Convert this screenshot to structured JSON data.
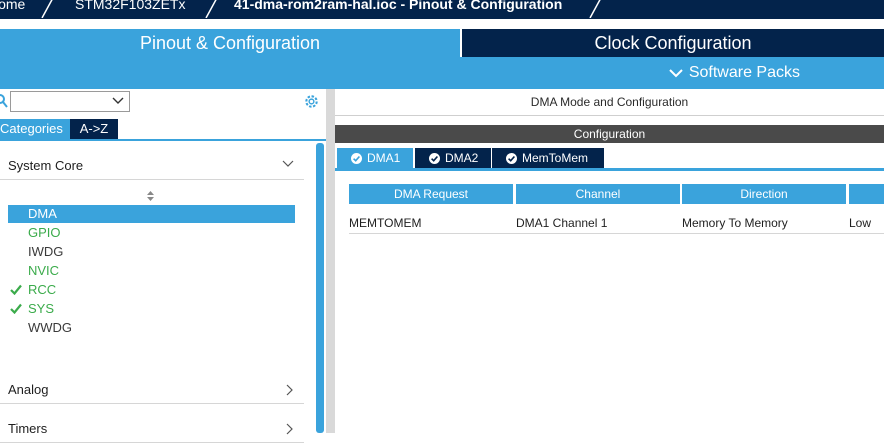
{
  "breadcrumb": [
    "Home",
    "STM32F103ZETx",
    "41-dma-rom2ram-hal.ioc - Pinout & Configuration"
  ],
  "tabs": {
    "pinout": "Pinout & Configuration",
    "clock": "Clock Configuration"
  },
  "software_packs": "Software Packs",
  "left_panel": {
    "search_value": "",
    "tab_categories": "Categories",
    "tab_az": "A->Z",
    "categories": [
      "System Core",
      "Analog",
      "Timers"
    ],
    "system_core_items": [
      {
        "label": "DMA",
        "state": "selected",
        "check": false
      },
      {
        "label": "GPIO",
        "state": "configured",
        "check": false
      },
      {
        "label": "IWDG",
        "state": "normal",
        "check": false
      },
      {
        "label": "NVIC",
        "state": "configured",
        "check": false
      },
      {
        "label": "RCC",
        "state": "configured",
        "check": true
      },
      {
        "label": "SYS",
        "state": "configured",
        "check": true
      },
      {
        "label": "WWDG",
        "state": "normal",
        "check": false
      }
    ]
  },
  "right_panel": {
    "mode_title": "DMA Mode and Configuration",
    "configuration_label": "Configuration",
    "dma_tabs": [
      "DMA1",
      "DMA2",
      "MemToMem"
    ],
    "table": {
      "headers": [
        "DMA Request",
        "Channel",
        "Direction",
        ""
      ],
      "rows": [
        [
          "MEMTOMEM",
          "DMA1 Channel 1",
          "Memory To Memory",
          "Low"
        ]
      ]
    }
  },
  "colors": {
    "accent": "#3aa3dc",
    "navy": "#03234b",
    "green": "#3bab4b"
  }
}
